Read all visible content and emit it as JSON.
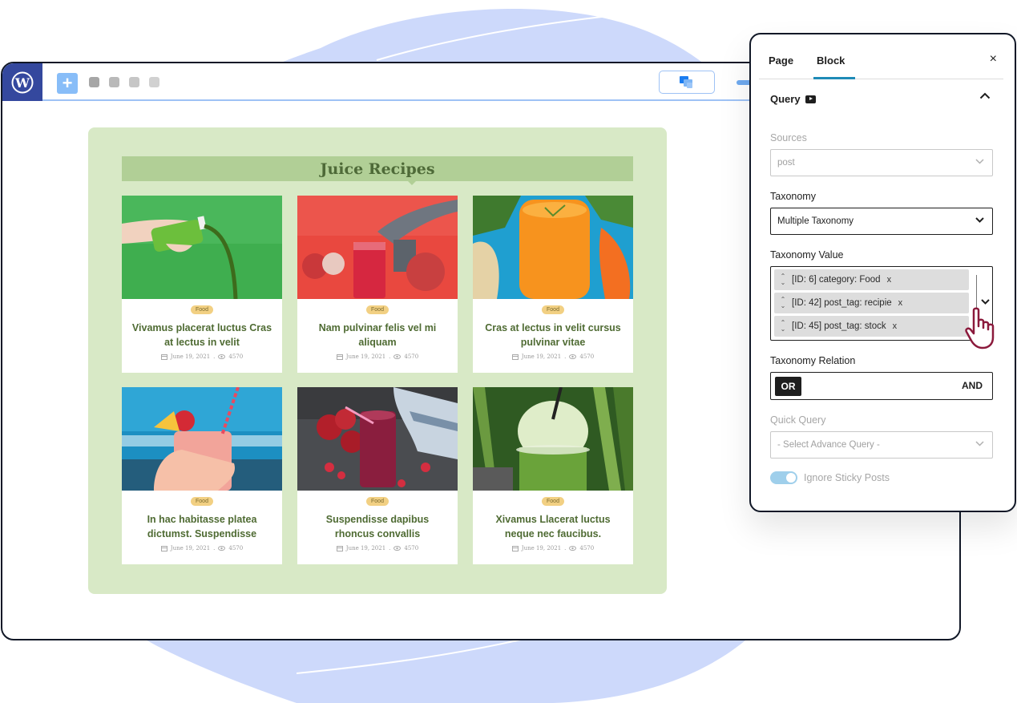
{
  "editor": {
    "logo_icon": "wordpress-logo-icon",
    "add_block_label": "+",
    "toolbar_placeholders": [
      {
        "color": "#a6a6a6"
      },
      {
        "color": "#b9b9b9"
      },
      {
        "color": "#c6c6c6"
      },
      {
        "color": "#d1d1d1"
      }
    ],
    "preview_icon": "responsive-preview-icon"
  },
  "block": {
    "heading": "Juice Recipes",
    "posts": [
      {
        "title": "Vivamus placerat luctus Cras at lectus in velit",
        "category": "Food",
        "date": "June 19, 2021",
        "views": "4570",
        "image": "green-juice-bottle-pour"
      },
      {
        "title": "Nam pulvinar felis vel mi aliquam",
        "category": "Food",
        "date": "June 19, 2021",
        "views": "4570",
        "image": "pomegranate-juice-press"
      },
      {
        "title": "Cras at lectus in velit cursus pulvinar vitae",
        "category": "Food",
        "date": "June 19, 2021",
        "views": "4570",
        "image": "carrot-ginger-juice"
      },
      {
        "title": "In hac habitasse platea dictumst. Suspendisse",
        "category": "Food",
        "date": "June 19, 2021",
        "views": "4570",
        "image": "strawberry-smoothie-beach"
      },
      {
        "title": "Suspendisse dapibus rhoncus convallis",
        "category": "Food",
        "date": "June 19, 2021",
        "views": "4570",
        "image": "berry-smoothie-table"
      },
      {
        "title": "Xivamus Llacerat luctus neque nec faucibus.",
        "category": "Food",
        "date": "June 19, 2021",
        "views": "4570",
        "image": "green-matcha-drink"
      }
    ]
  },
  "sidebar": {
    "tabs": [
      {
        "label": "Page",
        "active": false
      },
      {
        "label": "Block",
        "active": true
      }
    ],
    "close_label": "×",
    "section_title": "Query",
    "fields": {
      "sources": {
        "label": "Sources",
        "value": "post"
      },
      "taxonomy": {
        "label": "Taxonomy",
        "value": "Multiple Taxonomy"
      },
      "taxonomy_value": {
        "label": "Taxonomy Value",
        "tokens": [
          "[ID: 6] category: Food",
          "[ID: 42] post_tag: recipie",
          "[ID: 45] post_tag: stock"
        ],
        "remove_label": "x"
      },
      "taxonomy_relation": {
        "label": "Taxonomy Relation",
        "options": [
          "OR",
          "AND"
        ],
        "selected": "OR"
      },
      "quick_query": {
        "label": "Quick Query",
        "placeholder": "- Select Advance Query -"
      },
      "ignore_sticky": {
        "label": "Ignore Sticky Posts",
        "enabled": true
      }
    }
  },
  "colors": {
    "wp_blue": "#34489e",
    "canvas_green": "#d8e9c6",
    "heading_green": "#b1cf96",
    "title_green": "#4f6b33",
    "badge_yellow": "#f2d083",
    "tab_accent": "#1f8bb7",
    "toggle_blue": "#9fcfeb",
    "cursor_maroon": "#8b1a3c"
  }
}
